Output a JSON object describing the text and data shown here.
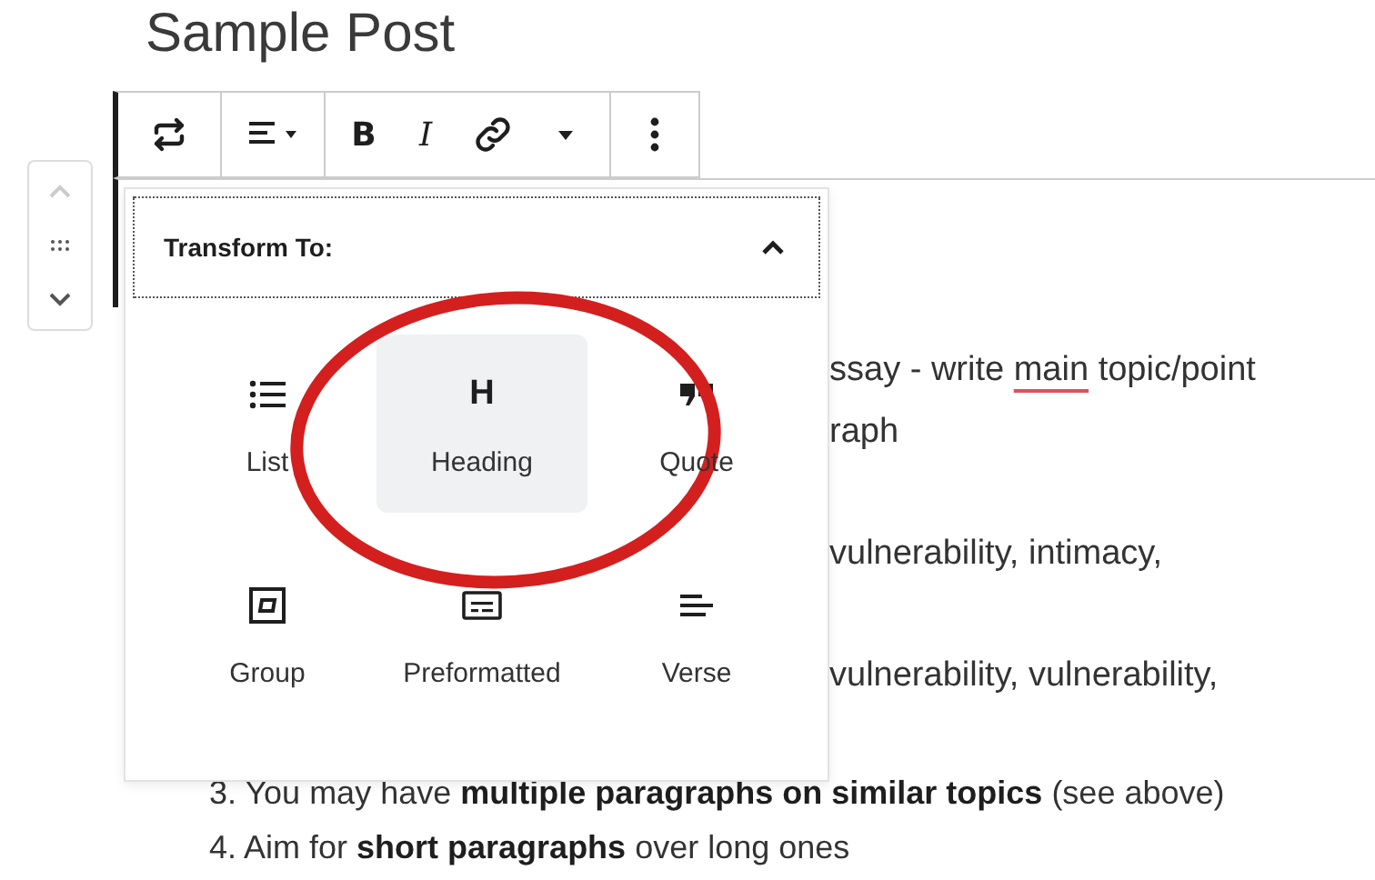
{
  "post_title": "Sample Post",
  "block_mover": {
    "move_up_disabled": true,
    "move_down_disabled": false
  },
  "toolbar": {
    "groups": [
      [
        {
          "kind": "transform"
        }
      ],
      [
        {
          "kind": "align"
        }
      ],
      [
        {
          "kind": "bold",
          "label": "B"
        },
        {
          "kind": "italic",
          "label": "I"
        },
        {
          "kind": "link"
        },
        {
          "kind": "more_caret"
        }
      ],
      [
        {
          "kind": "more"
        }
      ]
    ]
  },
  "transform_popover": {
    "title": "Transform To:",
    "expanded": true,
    "options": [
      {
        "kind": "list",
        "label": "List",
        "selected": false
      },
      {
        "kind": "heading",
        "label": "Heading",
        "glyph": "H",
        "selected": true
      },
      {
        "kind": "quote",
        "label": "Quote",
        "selected": false
      },
      {
        "kind": "group",
        "label": "Group",
        "selected": false
      },
      {
        "kind": "preformatted",
        "label": "Preformatted",
        "selected": false
      },
      {
        "kind": "verse",
        "label": "Verse",
        "selected": false
      }
    ]
  },
  "paragraph_lines": [
    {
      "parts": [
        {
          "text": "ssay - write "
        },
        {
          "text": "main",
          "misspelled": true
        },
        {
          "text": " topic/point"
        }
      ]
    },
    {
      "parts": [
        {
          "text": "raph"
        }
      ]
    },
    {
      "parts": [
        {
          "text": "vulnerability, intimacy,"
        }
      ]
    },
    {
      "parts": [
        {
          "text": "vulnerability, vulnerability,"
        }
      ]
    }
  ],
  "list_lines": [
    "3. You may have **multiple paragraphs on similar topics** (see above)",
    "4. Aim for **short paragraphs** over long ones"
  ],
  "annotation": {
    "kind": "ring"
  }
}
